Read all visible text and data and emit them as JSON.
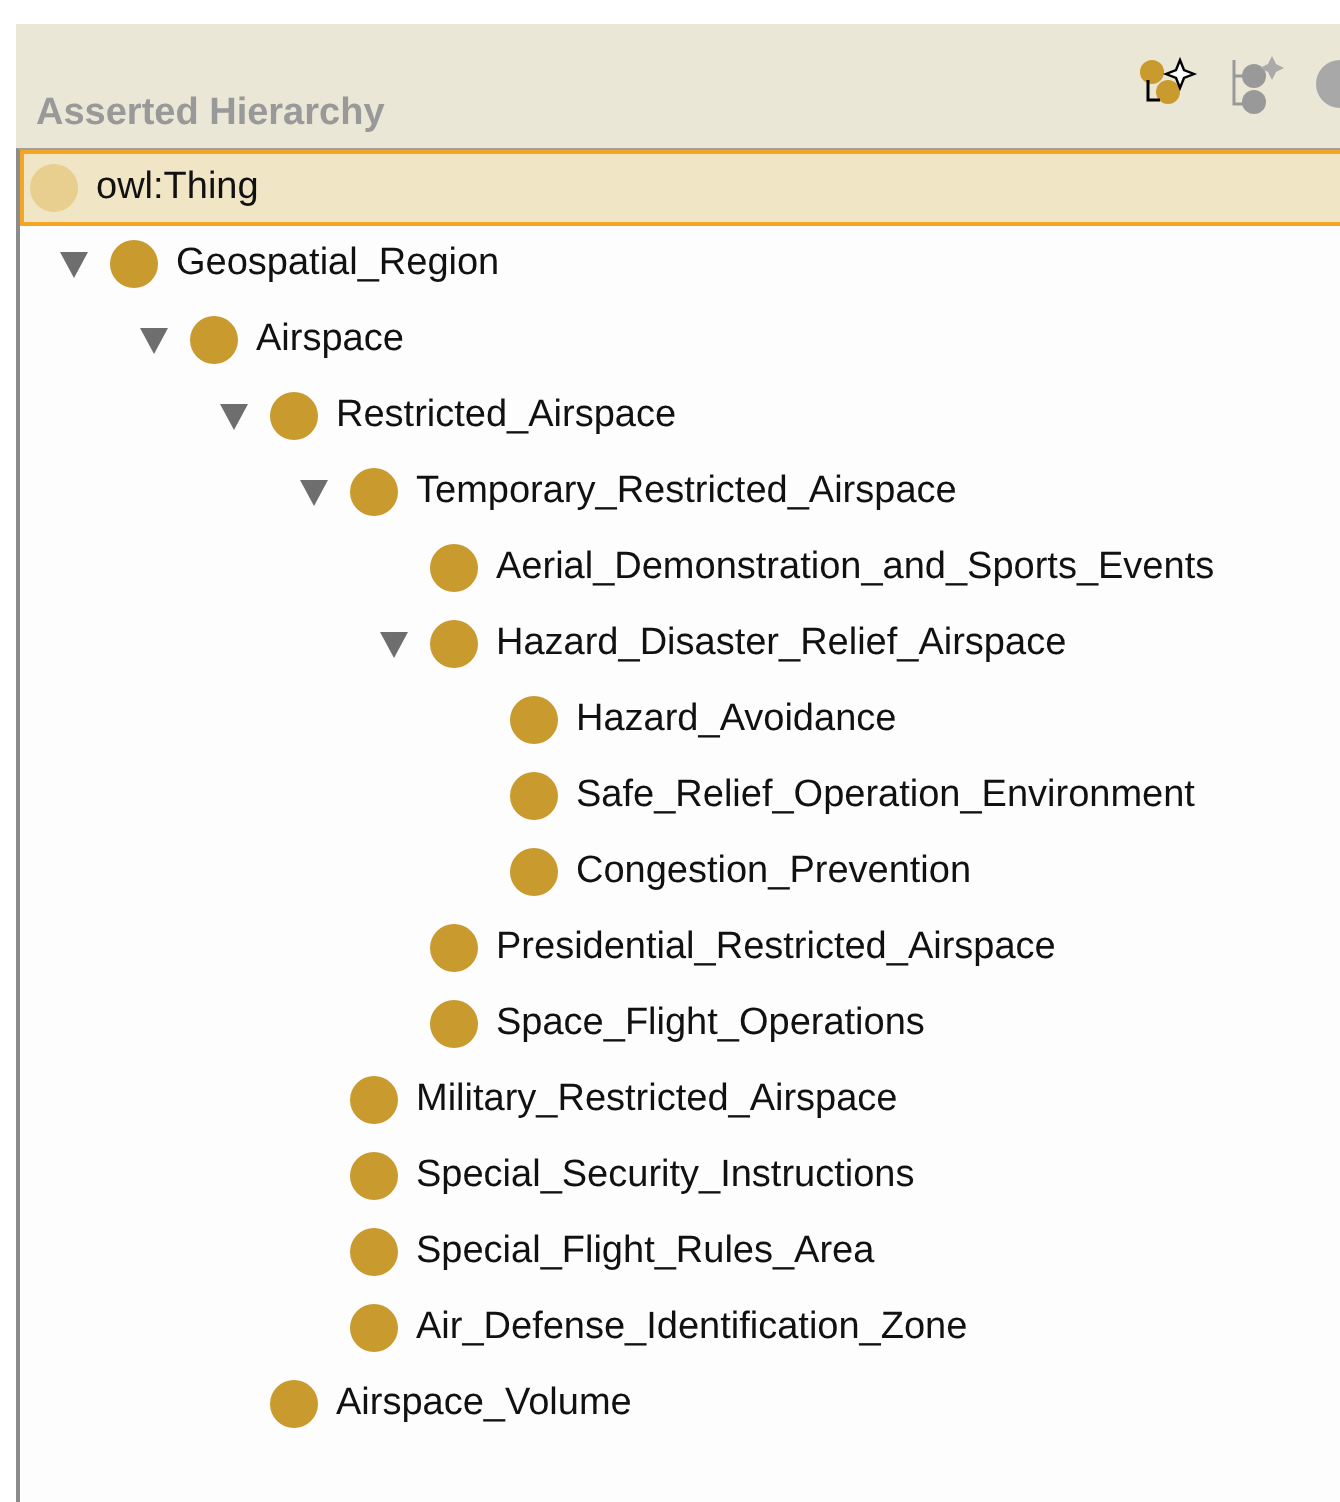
{
  "panel": {
    "title": "Asserted Hierarchy"
  },
  "tree": {
    "label": "owl:Thing",
    "selected": true,
    "children": [
      {
        "label": "Geospatial_Region",
        "selected": false,
        "expanded": true,
        "children": [
          {
            "label": "Airspace",
            "selected": false,
            "expanded": true,
            "children": [
              {
                "label": "Restricted_Airspace",
                "selected": false,
                "expanded": true,
                "children": [
                  {
                    "label": "Temporary_Restricted_Airspace",
                    "selected": false,
                    "expanded": true,
                    "children": [
                      {
                        "label": "Aerial_Demonstration_and_Sports_Events",
                        "selected": false
                      },
                      {
                        "label": "Hazard_Disaster_Relief_Airspace",
                        "selected": false,
                        "expanded": true,
                        "children": [
                          {
                            "label": "Hazard_Avoidance",
                            "selected": false
                          },
                          {
                            "label": "Safe_Relief_Operation_Environment",
                            "selected": false
                          },
                          {
                            "label": "Congestion_Prevention",
                            "selected": false
                          }
                        ]
                      },
                      {
                        "label": "Presidential_Restricted_Airspace",
                        "selected": false
                      },
                      {
                        "label": "Space_Flight_Operations",
                        "selected": false
                      }
                    ]
                  },
                  {
                    "label": "Military_Restricted_Airspace",
                    "selected": false
                  },
                  {
                    "label": "Special_Security_Instructions",
                    "selected": false
                  },
                  {
                    "label": "Special_Flight_Rules_Area",
                    "selected": false
                  },
                  {
                    "label": "Air_Defense_Identification_Zone",
                    "selected": false
                  }
                ]
              },
              {
                "label": "Airspace_Volume",
                "selected": false
              }
            ]
          }
        ]
      }
    ]
  }
}
